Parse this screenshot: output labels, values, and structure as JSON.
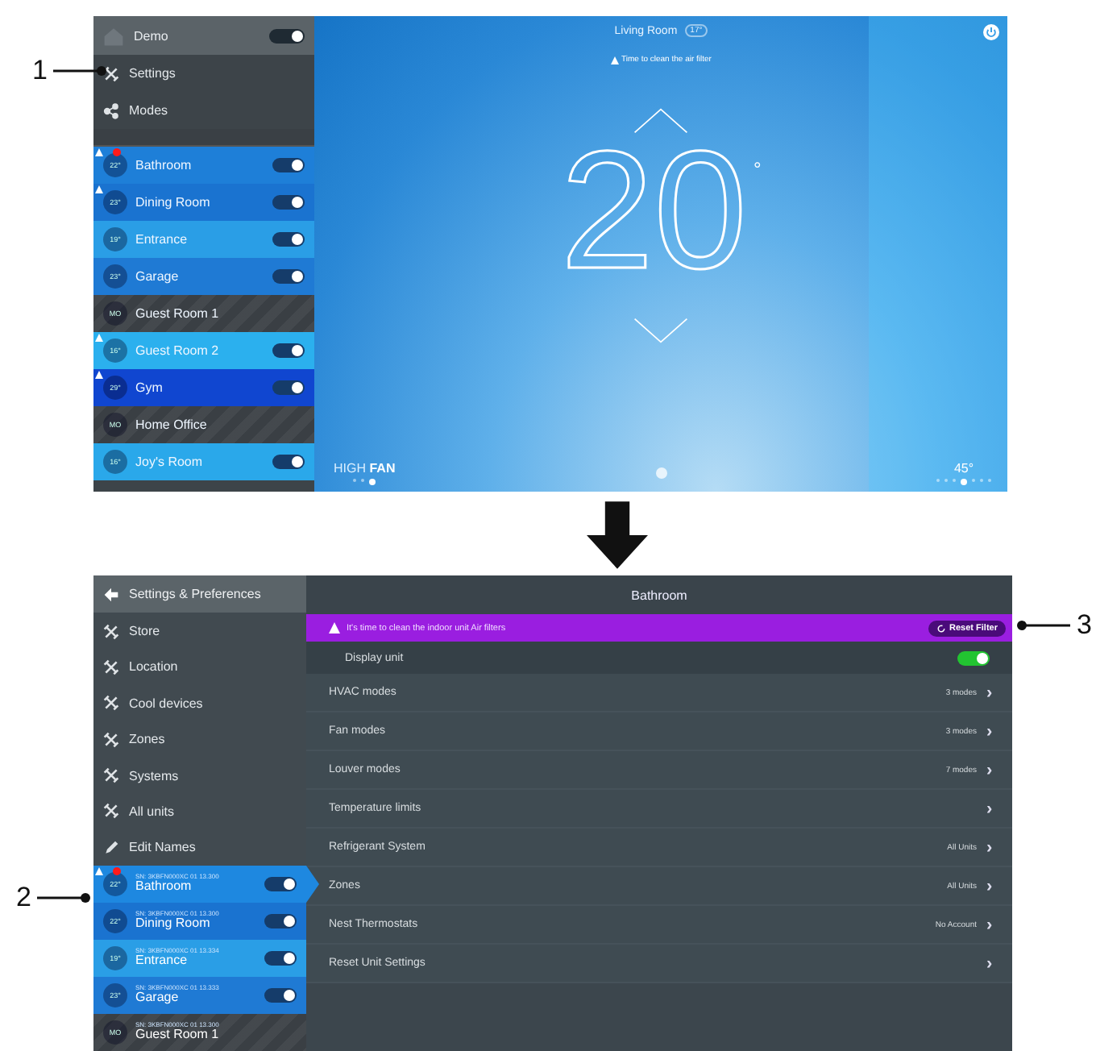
{
  "callouts": [
    {
      "number": "1"
    },
    {
      "number": "2"
    },
    {
      "number": "3"
    }
  ],
  "top_screen": {
    "sidebar": {
      "header": {
        "title": "Demo",
        "on": true
      },
      "menu": [
        {
          "label": "Settings",
          "kind": "tools"
        },
        {
          "label": "Modes",
          "kind": "share"
        }
      ],
      "rooms": [
        {
          "name": "Bathroom",
          "temp": "22°",
          "on": true,
          "alert": true,
          "badge": true,
          "color": "#1e7fd8"
        },
        {
          "name": "Dining Room",
          "temp": "23°",
          "on": true,
          "alert": true,
          "badge": false,
          "color": "#1a73d0"
        },
        {
          "name": "Entrance",
          "temp": "19°",
          "on": true,
          "alert": false,
          "badge": false,
          "color": "#2a9ee6"
        },
        {
          "name": "Garage",
          "temp": "23°",
          "on": true,
          "alert": false,
          "badge": false,
          "color": "#1f7ad4"
        },
        {
          "name": "Guest Room 1",
          "temp": "MO",
          "on": false,
          "alert": false,
          "badge": false,
          "color": "#3a3f44"
        },
        {
          "name": "Guest Room 2",
          "temp": "16°",
          "on": true,
          "alert": true,
          "badge": false,
          "color": "#2bb0ee"
        },
        {
          "name": "Gym",
          "temp": "29°",
          "on": true,
          "alert": true,
          "badge": false,
          "color": "#1046d0"
        },
        {
          "name": "Home Office",
          "temp": "MO",
          "on": false,
          "alert": false,
          "badge": false,
          "color": "#3a3f44"
        },
        {
          "name": "Joy's Room",
          "temp": "16°",
          "on": true,
          "alert": false,
          "badge": false,
          "color": "#2aa8ea"
        }
      ]
    },
    "main": {
      "title": "Living Room",
      "room_temp": "17°",
      "alert": "Time to clean the air filter",
      "setpoint": "20",
      "degree": "°",
      "fan": "HIGH **FAN**",
      "fan_pages": [
        false,
        false,
        true
      ],
      "louver": "45°",
      "louver_pages": [
        false,
        false,
        false,
        true,
        false,
        false,
        false
      ]
    }
  },
  "bottom_screen": {
    "sidebar": {
      "header": "Settings & Preferences",
      "menu": [
        {
          "label": "Store",
          "kind": "tools"
        },
        {
          "label": "Location",
          "kind": "tools"
        },
        {
          "label": "Cool devices",
          "kind": "tools"
        },
        {
          "label": "Zones",
          "kind": "tools"
        },
        {
          "label": "Systems",
          "kind": "tools"
        },
        {
          "label": "All units",
          "kind": "tools"
        },
        {
          "label": "Edit Names",
          "kind": "pencil"
        }
      ],
      "rooms": [
        {
          "name": "Bathroom",
          "serial": "SN: 3KBFN000XC 01 13.300",
          "temp": "22°",
          "on": true,
          "selected": true,
          "alert": true,
          "badge": true,
          "color": "#1e88e0"
        },
        {
          "name": "Dining Room",
          "serial": "SN: 3KBFN000XC 01 13.300",
          "temp": "22°",
          "on": true,
          "selected": false,
          "alert": false,
          "badge": false,
          "color": "#1a73d0"
        },
        {
          "name": "Entrance",
          "serial": "SN: 3KBFN000XC 01 13.334",
          "temp": "19°",
          "on": true,
          "selected": false,
          "alert": false,
          "badge": false,
          "color": "#2a9ee6"
        },
        {
          "name": "Garage",
          "serial": "SN: 3KBFN000XC 01 13.333",
          "temp": "23°",
          "on": true,
          "selected": false,
          "alert": false,
          "badge": false,
          "color": "#1f7ad4"
        },
        {
          "name": "Guest Room 1",
          "serial": "SN: 3KBFN000XC 01 13.300",
          "temp": "MO",
          "on": false,
          "selected": false,
          "alert": false,
          "badge": false,
          "color": "#3a3f44"
        }
      ]
    },
    "main": {
      "title": "Bathroom",
      "alert": "It's time to clean the indoor unit Air filters",
      "alert_button": "Reset Filter",
      "display_unit": {
        "label": "Display unit",
        "on": true
      },
      "settings": [
        {
          "label": "HVAC modes",
          "value": "3 modes",
          "chevron": "›"
        },
        {
          "label": "Fan modes",
          "value": "3 modes",
          "chevron": "›"
        },
        {
          "label": "Louver modes",
          "value": "7 modes",
          "chevron": "›"
        },
        {
          "label": "Temperature limits",
          "chevron": "›"
        },
        {
          "label": "Refrigerant System",
          "value": "All Units",
          "chevron": "›"
        },
        {
          "label": "Zones",
          "value": "All Units",
          "chevron": "›"
        },
        {
          "label": "Nest Thermostats",
          "value": "No Account",
          "chevron": "›"
        },
        {
          "label": "Reset Unit Settings",
          "chevron": "›"
        }
      ]
    }
  }
}
